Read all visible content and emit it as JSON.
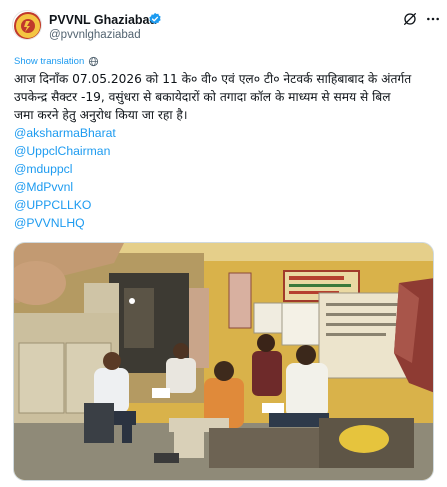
{
  "author": {
    "name": "PVVNL Ghaziabad",
    "handle": "@pvvnlghaziabad"
  },
  "translate": {
    "label": "Show translation"
  },
  "tweet": {
    "lines": [
      "आज दिनाँक 07.05.2026 को 11 के० वी० एवं एल० टी० नेटवर्क साहिबाबाद के अंतर्गत",
      "उपकेन्द्र सैक्टर -19, वसुंधरा से बकायेदारों को तगादा कॉल के माध्यम से समय से बिल",
      "जमा करने हेतु अनुरोध किया जा रहा है।"
    ],
    "mentions": [
      "@aksharmaBharat",
      "@UppclChairman",
      "@mduppcl",
      "@MdPvvnl",
      "@UPPCLLKO",
      "@PVVNLHQ"
    ]
  },
  "icons": {
    "verified": "verified-badge-icon",
    "grok": "grok-icon",
    "more": "more-options-icon",
    "globe": "translate-globe-icon"
  },
  "colors": {
    "accent": "#1d9bf0",
    "text": "#0f1419",
    "muted": "#536471"
  }
}
